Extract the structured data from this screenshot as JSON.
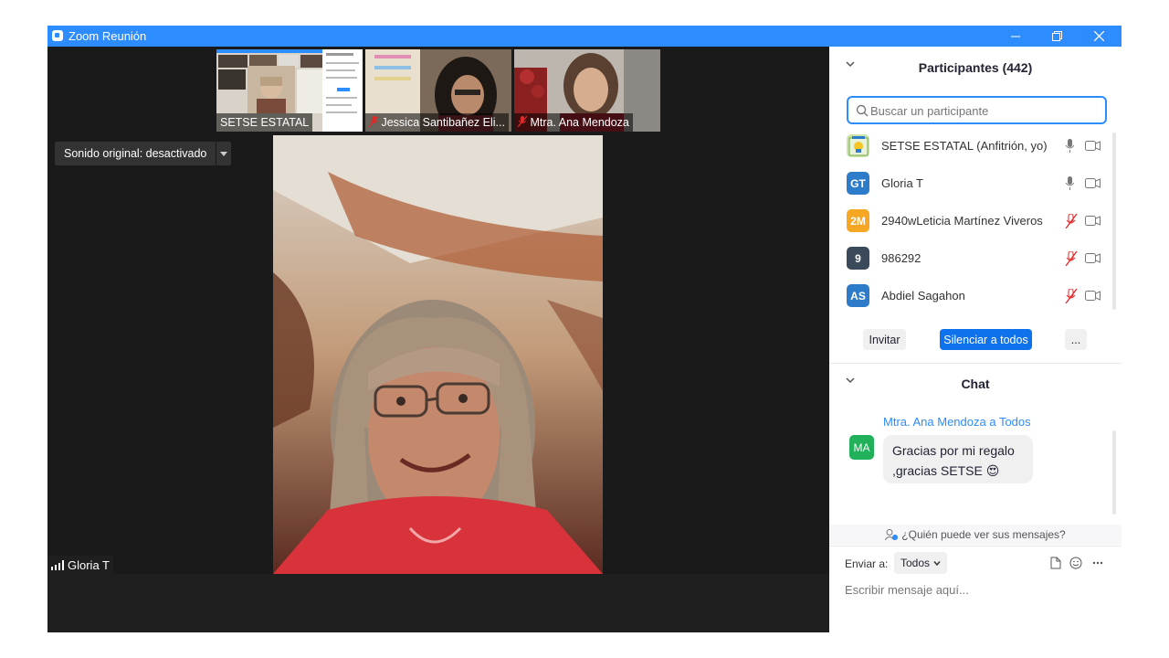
{
  "window": {
    "title": "Zoom Reunión",
    "controls": [
      "minimize",
      "restore",
      "close"
    ]
  },
  "gallery": {
    "thumbnails": [
      {
        "name": "SETSE ESTATAL",
        "muted": false
      },
      {
        "name": "Jessica Santibañez Eli...",
        "muted": true
      },
      {
        "name": "Mtra. Ana Mendoza",
        "muted": true
      }
    ],
    "next_icon": "chevron-right-icon"
  },
  "main_video": {
    "sound_button": "Sonido original: desactivado",
    "speaker_name": "Gloria T"
  },
  "participants": {
    "header": "Participantes (442)",
    "search_placeholder": "Buscar un participante",
    "items": [
      {
        "initials": "",
        "name": "SETSE ESTATAL (Anfitrión, yo)",
        "color": "#c9e6a8",
        "muted": false
      },
      {
        "initials": "GT",
        "name": "Gloria T",
        "color": "#2d7cc9",
        "muted": false
      },
      {
        "initials": "2M",
        "name": "2940wLeticia Martínez Viveros",
        "color": "#f5a623",
        "muted": true
      },
      {
        "initials": "9",
        "name": "986292",
        "color": "#3a4a5a",
        "muted": true
      },
      {
        "initials": "AS",
        "name": "Abdiel Sagahon",
        "color": "#2d7cc9",
        "muted": true
      }
    ],
    "invite_label": "Invitar",
    "mute_all_label": "Silenciar a todos",
    "more_label": "..."
  },
  "chat": {
    "header": "Chat",
    "messages": [
      {
        "sender": "Mtra. Ana Mendoza a Todos",
        "initials": "MA",
        "text_line1": "Gracias por mi regalo",
        "text_line2": ",gracias SETSE",
        "emoji": "😍"
      }
    ],
    "who_can_see": "¿Quién puede ver sus mensajes?",
    "send_to_label": "Enviar a:",
    "recipient": "Todos",
    "input_placeholder": "Escribir mensaje aquí..."
  },
  "colors": {
    "accent": "#2d8cff",
    "muted_red": "#e02828",
    "video_bg": "#1a1a1a"
  }
}
